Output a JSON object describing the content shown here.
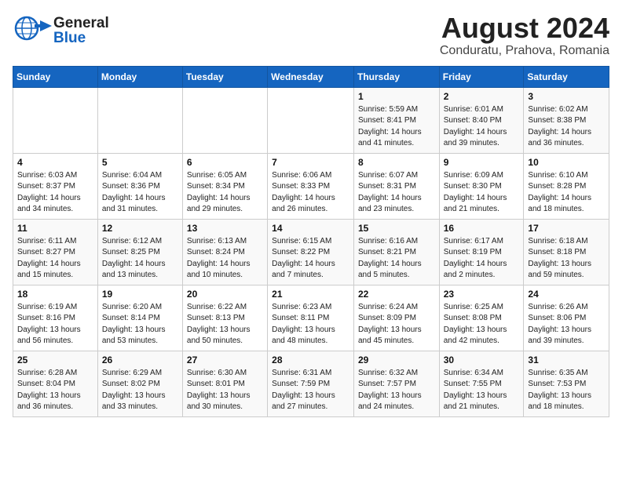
{
  "header": {
    "logo_general": "General",
    "logo_blue": "Blue",
    "month_title": "August 2024",
    "location": "Conduratu, Prahova, Romania"
  },
  "weekdays": [
    "Sunday",
    "Monday",
    "Tuesday",
    "Wednesday",
    "Thursday",
    "Friday",
    "Saturday"
  ],
  "weeks": [
    [
      {
        "day": "",
        "info": ""
      },
      {
        "day": "",
        "info": ""
      },
      {
        "day": "",
        "info": ""
      },
      {
        "day": "",
        "info": ""
      },
      {
        "day": "1",
        "info": "Sunrise: 5:59 AM\nSunset: 8:41 PM\nDaylight: 14 hours\nand 41 minutes."
      },
      {
        "day": "2",
        "info": "Sunrise: 6:01 AM\nSunset: 8:40 PM\nDaylight: 14 hours\nand 39 minutes."
      },
      {
        "day": "3",
        "info": "Sunrise: 6:02 AM\nSunset: 8:38 PM\nDaylight: 14 hours\nand 36 minutes."
      }
    ],
    [
      {
        "day": "4",
        "info": "Sunrise: 6:03 AM\nSunset: 8:37 PM\nDaylight: 14 hours\nand 34 minutes."
      },
      {
        "day": "5",
        "info": "Sunrise: 6:04 AM\nSunset: 8:36 PM\nDaylight: 14 hours\nand 31 minutes."
      },
      {
        "day": "6",
        "info": "Sunrise: 6:05 AM\nSunset: 8:34 PM\nDaylight: 14 hours\nand 29 minutes."
      },
      {
        "day": "7",
        "info": "Sunrise: 6:06 AM\nSunset: 8:33 PM\nDaylight: 14 hours\nand 26 minutes."
      },
      {
        "day": "8",
        "info": "Sunrise: 6:07 AM\nSunset: 8:31 PM\nDaylight: 14 hours\nand 23 minutes."
      },
      {
        "day": "9",
        "info": "Sunrise: 6:09 AM\nSunset: 8:30 PM\nDaylight: 14 hours\nand 21 minutes."
      },
      {
        "day": "10",
        "info": "Sunrise: 6:10 AM\nSunset: 8:28 PM\nDaylight: 14 hours\nand 18 minutes."
      }
    ],
    [
      {
        "day": "11",
        "info": "Sunrise: 6:11 AM\nSunset: 8:27 PM\nDaylight: 14 hours\nand 15 minutes."
      },
      {
        "day": "12",
        "info": "Sunrise: 6:12 AM\nSunset: 8:25 PM\nDaylight: 14 hours\nand 13 minutes."
      },
      {
        "day": "13",
        "info": "Sunrise: 6:13 AM\nSunset: 8:24 PM\nDaylight: 14 hours\nand 10 minutes."
      },
      {
        "day": "14",
        "info": "Sunrise: 6:15 AM\nSunset: 8:22 PM\nDaylight: 14 hours\nand 7 minutes."
      },
      {
        "day": "15",
        "info": "Sunrise: 6:16 AM\nSunset: 8:21 PM\nDaylight: 14 hours\nand 5 minutes."
      },
      {
        "day": "16",
        "info": "Sunrise: 6:17 AM\nSunset: 8:19 PM\nDaylight: 14 hours\nand 2 minutes."
      },
      {
        "day": "17",
        "info": "Sunrise: 6:18 AM\nSunset: 8:18 PM\nDaylight: 13 hours\nand 59 minutes."
      }
    ],
    [
      {
        "day": "18",
        "info": "Sunrise: 6:19 AM\nSunset: 8:16 PM\nDaylight: 13 hours\nand 56 minutes."
      },
      {
        "day": "19",
        "info": "Sunrise: 6:20 AM\nSunset: 8:14 PM\nDaylight: 13 hours\nand 53 minutes."
      },
      {
        "day": "20",
        "info": "Sunrise: 6:22 AM\nSunset: 8:13 PM\nDaylight: 13 hours\nand 50 minutes."
      },
      {
        "day": "21",
        "info": "Sunrise: 6:23 AM\nSunset: 8:11 PM\nDaylight: 13 hours\nand 48 minutes."
      },
      {
        "day": "22",
        "info": "Sunrise: 6:24 AM\nSunset: 8:09 PM\nDaylight: 13 hours\nand 45 minutes."
      },
      {
        "day": "23",
        "info": "Sunrise: 6:25 AM\nSunset: 8:08 PM\nDaylight: 13 hours\nand 42 minutes."
      },
      {
        "day": "24",
        "info": "Sunrise: 6:26 AM\nSunset: 8:06 PM\nDaylight: 13 hours\nand 39 minutes."
      }
    ],
    [
      {
        "day": "25",
        "info": "Sunrise: 6:28 AM\nSunset: 8:04 PM\nDaylight: 13 hours\nand 36 minutes."
      },
      {
        "day": "26",
        "info": "Sunrise: 6:29 AM\nSunset: 8:02 PM\nDaylight: 13 hours\nand 33 minutes."
      },
      {
        "day": "27",
        "info": "Sunrise: 6:30 AM\nSunset: 8:01 PM\nDaylight: 13 hours\nand 30 minutes."
      },
      {
        "day": "28",
        "info": "Sunrise: 6:31 AM\nSunset: 7:59 PM\nDaylight: 13 hours\nand 27 minutes."
      },
      {
        "day": "29",
        "info": "Sunrise: 6:32 AM\nSunset: 7:57 PM\nDaylight: 13 hours\nand 24 minutes."
      },
      {
        "day": "30",
        "info": "Sunrise: 6:34 AM\nSunset: 7:55 PM\nDaylight: 13 hours\nand 21 minutes."
      },
      {
        "day": "31",
        "info": "Sunrise: 6:35 AM\nSunset: 7:53 PM\nDaylight: 13 hours\nand 18 minutes."
      }
    ]
  ]
}
